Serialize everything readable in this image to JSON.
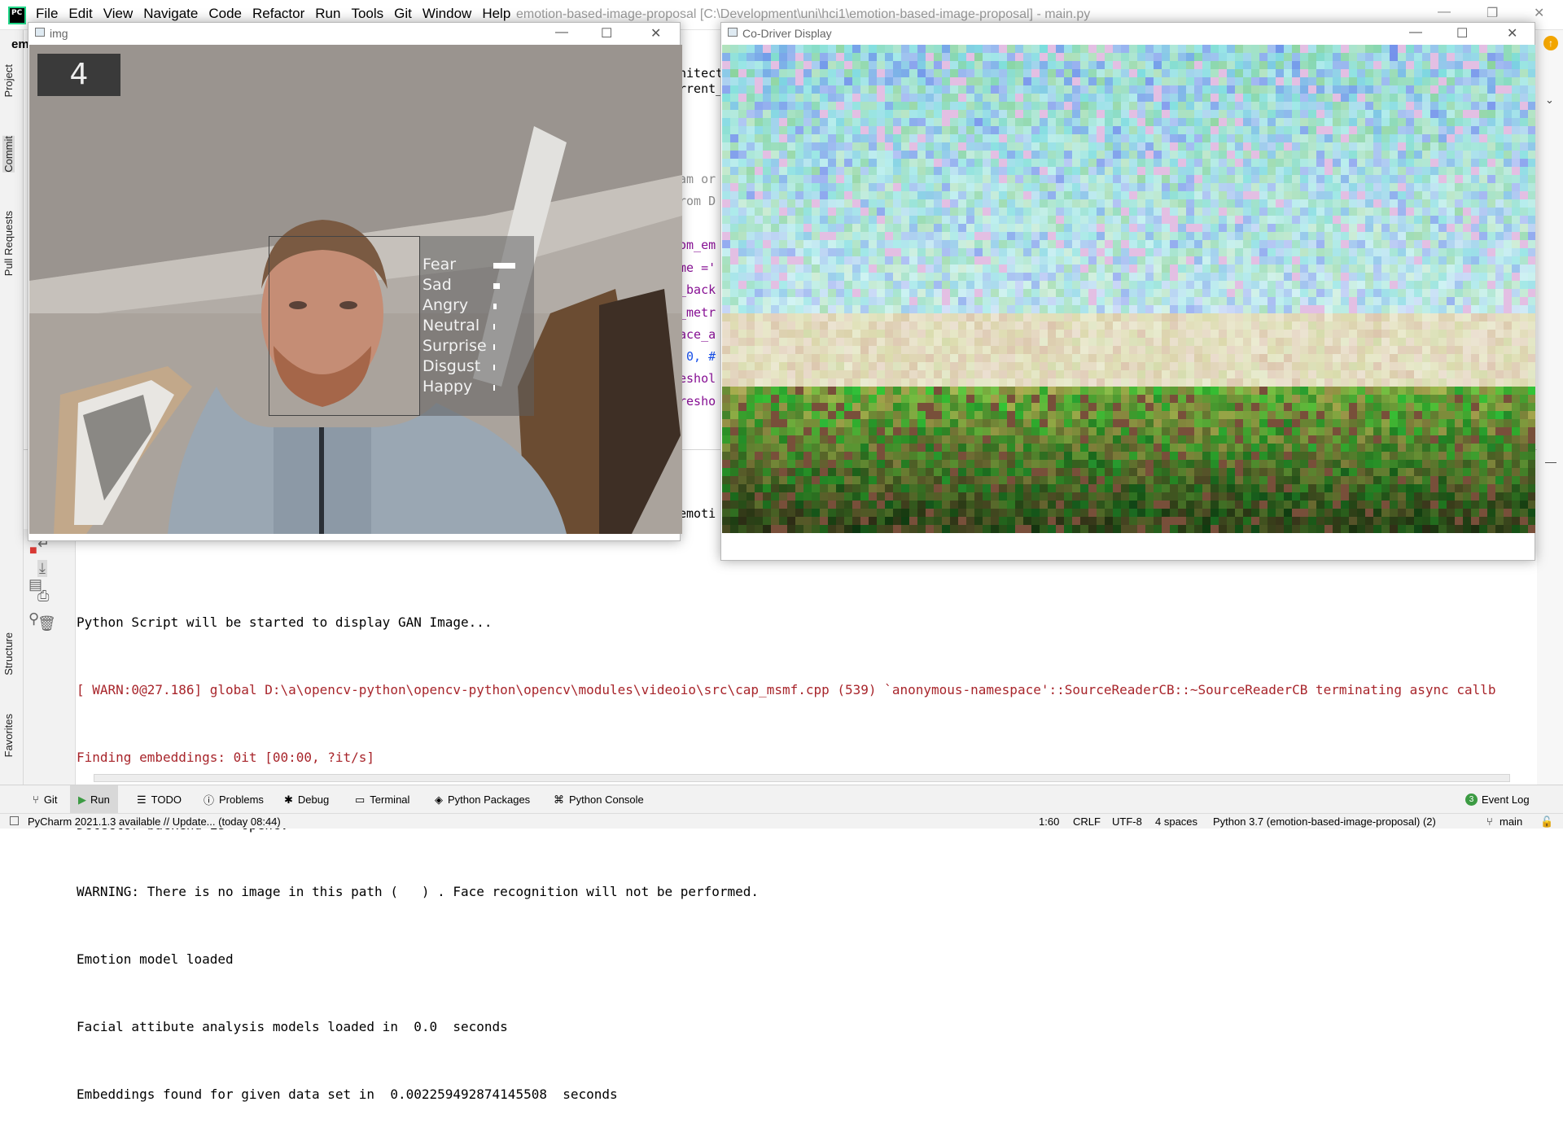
{
  "menubar": {
    "items": [
      "File",
      "Edit",
      "View",
      "Navigate",
      "Code",
      "Refactor",
      "Run",
      "Tools",
      "Git",
      "Window",
      "Help"
    ],
    "window_title": "emotion-based-image-proposal [C:\\Development\\uni\\hci1\\emotion-based-image-proposal] - main.py"
  },
  "left_strip": {
    "project": "Project",
    "commit": "Commit",
    "pull_requests": "Pull Requests",
    "structure": "Structure",
    "favorites": "Favorites",
    "tab_prefix": "em"
  },
  "editor_fragments": [
    "hitectur",
    "rrent_",
    "am or",
    "rom D",
    "om_em",
    "me ='",
    "_back",
    "_metr",
    "ace_a",
    " 0, #",
    "eshol",
    "resho",
    "emoti"
  ],
  "img_window": {
    "title": "img",
    "counter": "4",
    "emotions": [
      {
        "label": "Fear",
        "value": 0.85
      },
      {
        "label": "Sad",
        "value": 0.25
      },
      {
        "label": "Angry",
        "value": 0.12
      },
      {
        "label": "Neutral",
        "value": 0.03
      },
      {
        "label": "Surprise",
        "value": 0.03
      },
      {
        "label": "Disgust",
        "value": 0.03
      },
      {
        "label": "Happy",
        "value": 0.03
      }
    ]
  },
  "codriver_window": {
    "title": "Co-Driver Display"
  },
  "console": {
    "lines": [
      {
        "text": "Python Script will be started to display GAN Image...",
        "kind": "normal"
      },
      {
        "text": "[ WARN:0@27.186] global D:\\a\\opencv-python\\opencv-python\\opencv\\modules\\videoio\\src\\cap_msmf.cpp (539) `anonymous-namespace'::SourceReaderCB::~SourceReaderCB terminating async callb",
        "kind": "error"
      },
      {
        "text": "Finding embeddings: 0it [00:00, ?it/s]",
        "kind": "error"
      },
      {
        "text": "Detector backend is  opencv",
        "kind": "normal"
      },
      {
        "text": "WARNING: There is no image in this path (   ) . Face recognition will not be performed.",
        "kind": "normal"
      },
      {
        "text": "Emotion model loaded",
        "kind": "normal"
      },
      {
        "text": "Facial attibute analysis models loaded in  0.0  seconds",
        "kind": "normal"
      },
      {
        "text": "Embeddings found for given data set in  0.002259492874145508  seconds",
        "kind": "normal"
      }
    ]
  },
  "bottom_tabs": {
    "git": "Git",
    "run": "Run",
    "todo": "TODO",
    "problems": "Problems",
    "debug": "Debug",
    "terminal": "Terminal",
    "python_packages": "Python Packages",
    "python_console": "Python Console",
    "event_log": "Event Log",
    "event_log_count": "3"
  },
  "status": {
    "update": "PyCharm 2021.1.3 available // Update... (today 08:44)",
    "position": "1:60",
    "line_sep": "CRLF",
    "encoding": "UTF-8",
    "indent": "4 spaces",
    "interpreter": "Python 3.7 (emotion-based-image-proposal) (2)",
    "branch": "main"
  },
  "colors": {
    "error_text": "#a8252b",
    "accent_green": "#21d789",
    "active_tab": "#d8d8d8"
  }
}
